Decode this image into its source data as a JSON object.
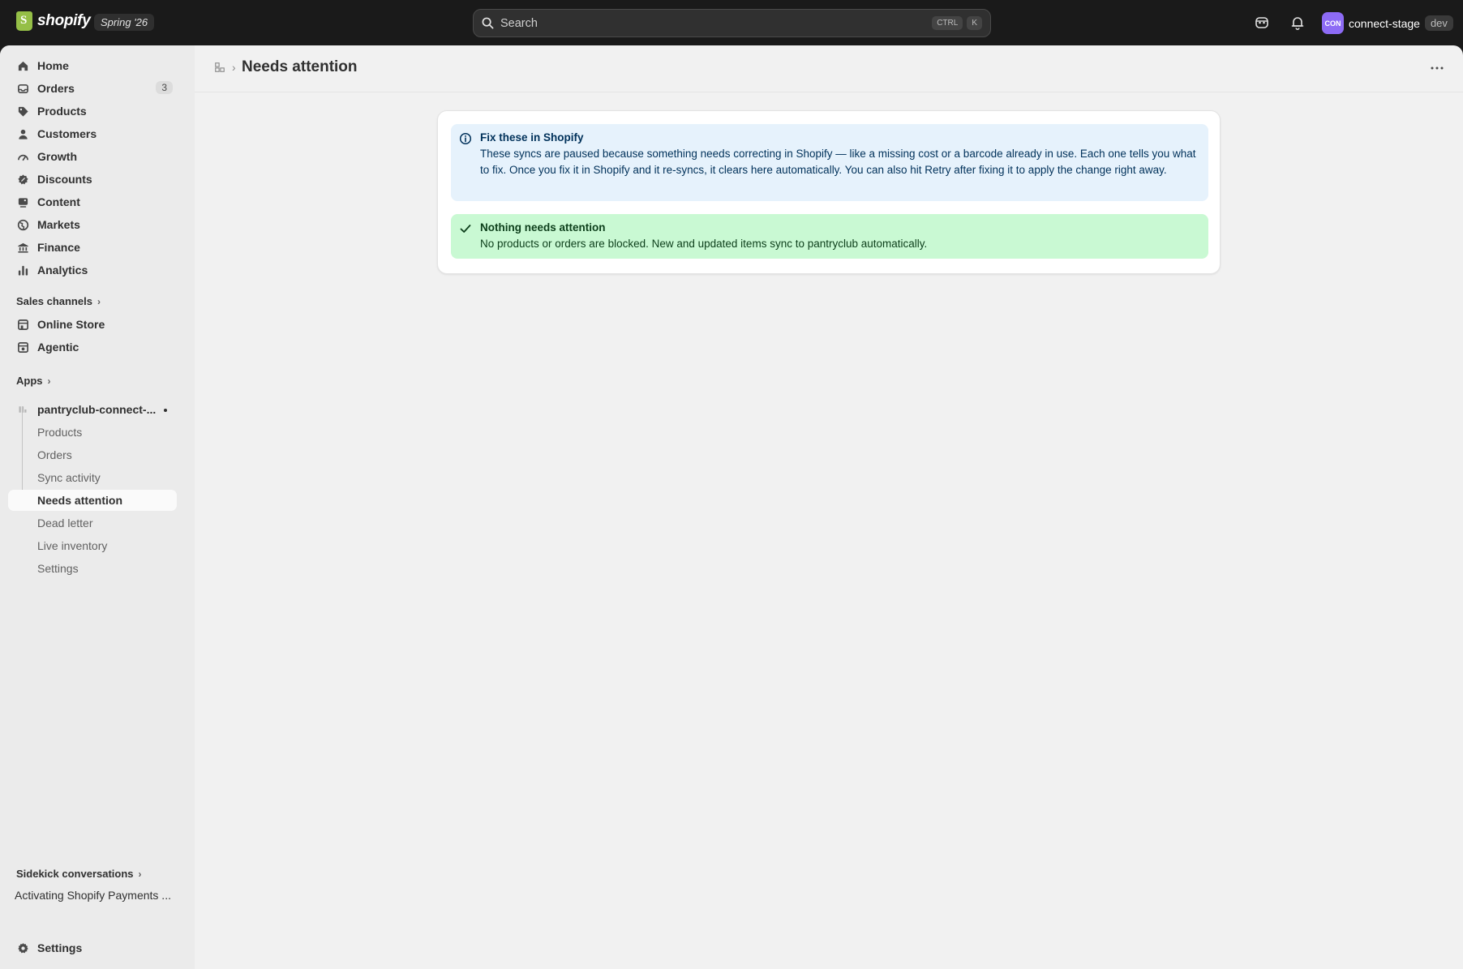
{
  "topbar": {
    "brand": "shopify",
    "release_badge": "Spring '26",
    "search_placeholder": "Search",
    "kbd_modifier": "CTRL",
    "kbd_key": "K",
    "account_initials": "CON",
    "account_name": "connect-stage",
    "env_badge": "dev"
  },
  "sidebar": {
    "items": [
      {
        "label": "Home",
        "icon": "home-icon"
      },
      {
        "label": "Orders",
        "icon": "inbox-icon",
        "count": "3"
      },
      {
        "label": "Products",
        "icon": "tag-icon"
      },
      {
        "label": "Customers",
        "icon": "person-icon"
      },
      {
        "label": "Growth",
        "icon": "gauge-icon"
      },
      {
        "label": "Discounts",
        "icon": "discount-icon"
      },
      {
        "label": "Content",
        "icon": "content-icon"
      },
      {
        "label": "Markets",
        "icon": "globe-icon"
      },
      {
        "label": "Finance",
        "icon": "bank-icon"
      },
      {
        "label": "Analytics",
        "icon": "bar-chart-icon"
      }
    ],
    "sales_channels_label": "Sales channels",
    "channels": [
      {
        "label": "Online Store",
        "icon": "store-icon"
      },
      {
        "label": "Agentic",
        "icon": "agentic-icon"
      }
    ],
    "apps_label": "Apps",
    "app": {
      "name": "pantryclub-connect-...",
      "subitems": [
        "Products",
        "Orders",
        "Sync activity",
        "Needs attention",
        "Dead letter",
        "Live inventory",
        "Settings"
      ],
      "active": "Needs attention"
    },
    "sidekick_label": "Sidekick conversations",
    "sidekick_item": "Activating Shopify Payments ...",
    "settings_label": "Settings"
  },
  "page": {
    "title": "Needs attention",
    "info_banner": {
      "title": "Fix these in Shopify",
      "body": "These syncs are paused because something needs correcting in Shopify — like a missing cost or a barcode already in use. Each one tells you what to fix. Once you fix it in Shopify and it re-syncs, it clears here automatically. You can also hit Retry after fixing it to apply the change right away."
    },
    "success_banner": {
      "title": "Nothing needs attention",
      "body": "No products or orders are blocked. New and updated items sync to pantryclub automatically."
    }
  },
  "colors": {
    "topbar_bg": "#1a1a1a",
    "avatar_bg": "#8d6bf5",
    "info_bg": "#e6f2fc",
    "success_bg": "#c9f9d3"
  }
}
